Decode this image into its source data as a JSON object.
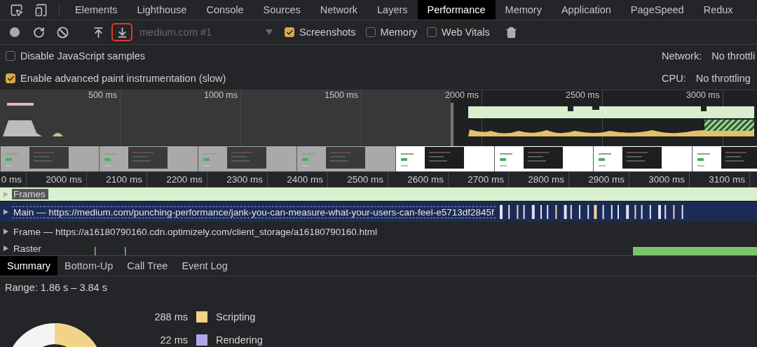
{
  "top_tabs": [
    {
      "label": "Elements",
      "selected": false
    },
    {
      "label": "Lighthouse",
      "selected": false
    },
    {
      "label": "Console",
      "selected": false
    },
    {
      "label": "Sources",
      "selected": false
    },
    {
      "label": "Network",
      "selected": false
    },
    {
      "label": "Layers",
      "selected": false
    },
    {
      "label": "Performance",
      "selected": true
    },
    {
      "label": "Memory",
      "selected": false
    },
    {
      "label": "Application",
      "selected": false
    },
    {
      "label": "PageSpeed",
      "selected": false
    },
    {
      "label": "Redux",
      "selected": false
    }
  ],
  "toolbar": {
    "buttons": [
      {
        "kind": "record",
        "highlighted": false
      },
      {
        "kind": "reload",
        "highlighted": false
      },
      {
        "kind": "clear",
        "highlighted": false
      },
      {
        "kind": "load",
        "highlighted": false
      },
      {
        "kind": "save",
        "highlighted": true
      }
    ],
    "target": "medium.com #1",
    "options": [
      {
        "label": "Screenshots",
        "checked": true
      },
      {
        "label": "Memory",
        "checked": false
      },
      {
        "label": "Web Vitals",
        "checked": false
      }
    ]
  },
  "settings": [
    {
      "label": "Disable JavaScript samples",
      "checked": false,
      "setting": "Network:",
      "value": "No throttli"
    },
    {
      "label": "Enable advanced paint instrumentation (slow)",
      "checked": true,
      "setting": "CPU:",
      "value": "No throttling"
    }
  ],
  "overview": {
    "ticks": [
      "500 ms",
      "1000 ms",
      "1500 ms",
      "2000 ms",
      "2500 ms",
      "3000 ms"
    ],
    "screenshots": [
      {
        "kind": "picture",
        "selected": false
      },
      {
        "kind": "picture",
        "selected": false
      },
      {
        "kind": "picture",
        "selected": false
      },
      {
        "kind": "picture",
        "selected": false
      },
      {
        "kind": "picture",
        "selected": true
      },
      {
        "kind": "picture",
        "selected": true
      },
      {
        "kind": "picture",
        "selected": true
      },
      {
        "kind": "picture",
        "selected": true
      }
    ]
  },
  "ruler": [
    "0 ms",
    "2000 ms",
    "2100 ms",
    "2200 ms",
    "2300 ms",
    "2400 ms",
    "2500 ms",
    "2600 ms",
    "2700 ms",
    "2800 ms",
    "2900 ms",
    "3000 ms",
    "3100 ms"
  ],
  "tracks": [
    {
      "kind": "frames",
      "label": "Frames"
    },
    {
      "kind": "main",
      "label": "Main — https://medium.com/punching-performance/jank-you-can-measure-what-your-users-can-feel-e5713df2845f"
    },
    {
      "kind": "frame",
      "label": "Frame — https://a16180790160.cdn.optimizely.com/client_storage/a16180790160.html"
    },
    {
      "kind": "raster",
      "label": "Raster"
    }
  ],
  "bottom_tabs": [
    {
      "label": "Summary",
      "selected": true
    },
    {
      "label": "Bottom-Up",
      "selected": false
    },
    {
      "label": "Call Tree",
      "selected": false
    },
    {
      "label": "Event Log",
      "selected": false
    }
  ],
  "summary": {
    "range": "Range: 1.86 s – 3.84 s",
    "legend": [
      {
        "value": "288 ms",
        "label": "Scripting",
        "color": "#f2d488"
      },
      {
        "value": "22 ms",
        "label": "Rendering",
        "color": "#b3a6e8"
      }
    ]
  }
}
